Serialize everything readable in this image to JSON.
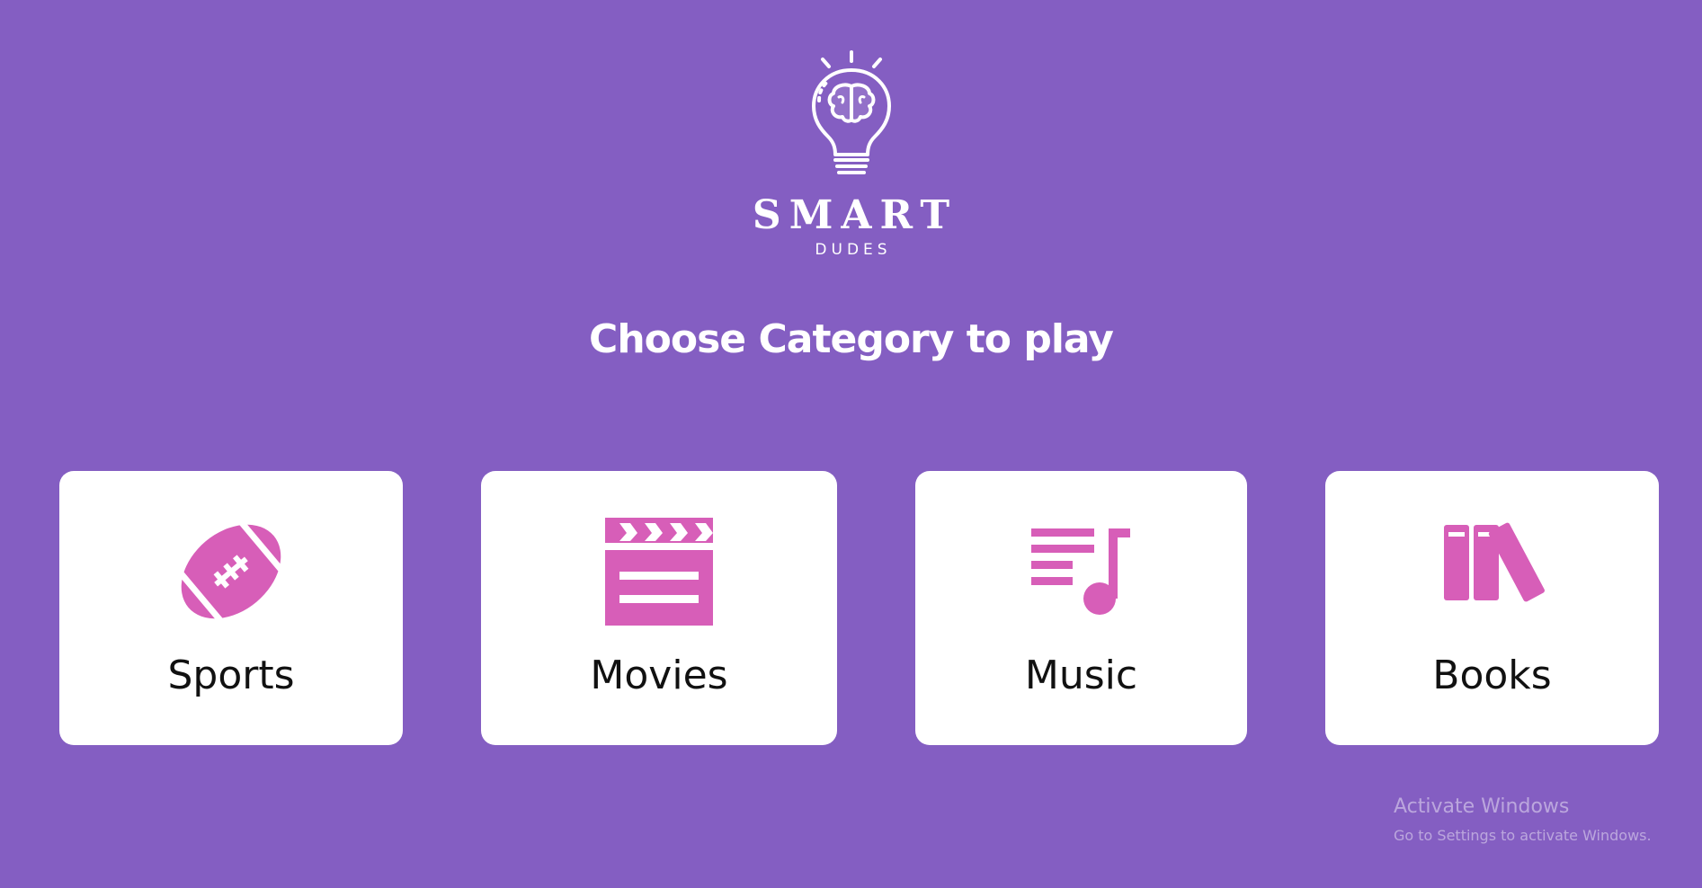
{
  "brand": {
    "name": "SMART",
    "subtitle": "DUDES",
    "logo_icon": "brain-lightbulb-icon"
  },
  "headline": "Choose Category to play",
  "accent_color": "#d75eb8",
  "background_color": "#845ec2",
  "categories": [
    {
      "label": "Sports",
      "icon": "football-icon"
    },
    {
      "label": "Movies",
      "icon": "clapperboard-icon"
    },
    {
      "label": "Music",
      "icon": "playlist-icon"
    },
    {
      "label": "Books",
      "icon": "books-icon"
    }
  ],
  "watermark": {
    "title": "Activate Windows",
    "subtitle": "Go to Settings to activate Windows."
  }
}
